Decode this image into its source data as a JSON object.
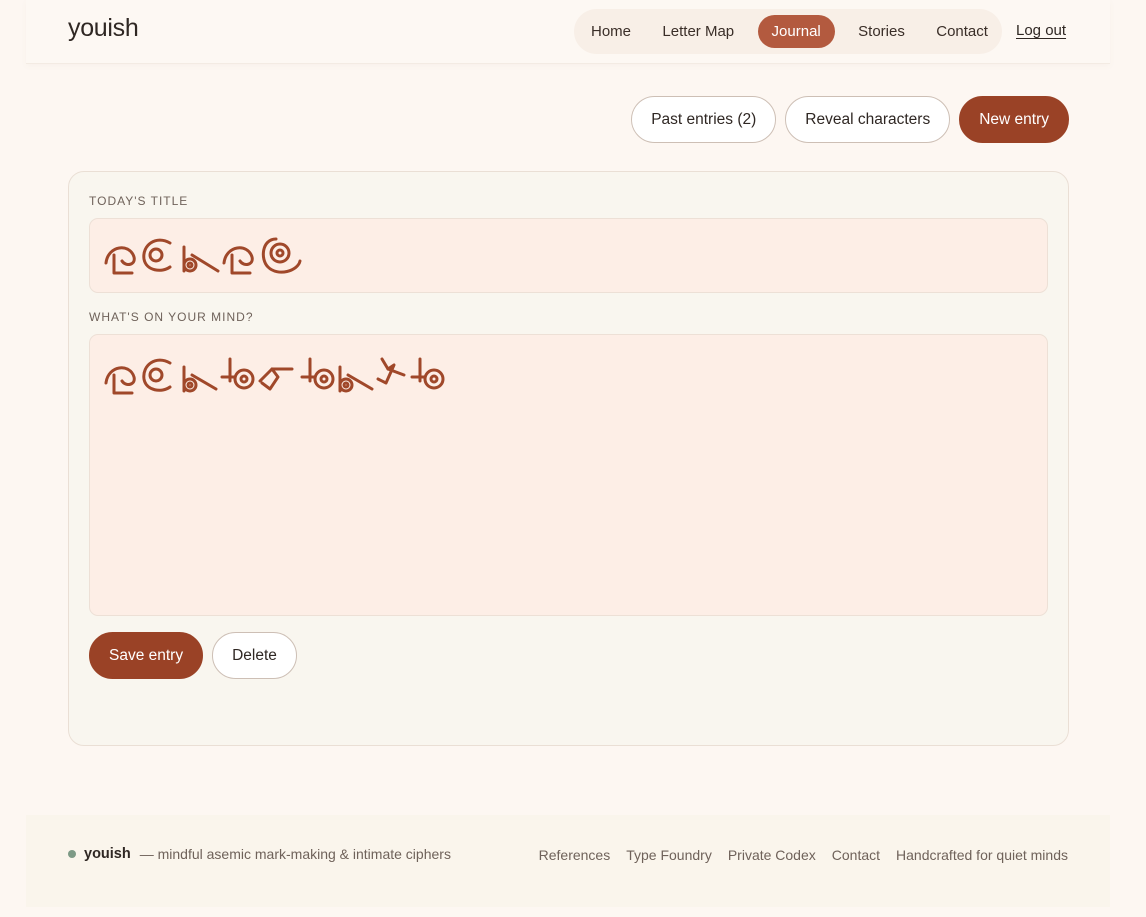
{
  "header": {
    "logo": "youish",
    "nav": [
      {
        "label": "Home",
        "active": false
      },
      {
        "label": "Letter Map",
        "active": false
      },
      {
        "label": "Journal",
        "active": true
      },
      {
        "label": "Stories",
        "active": false
      },
      {
        "label": "Contact",
        "active": false
      }
    ],
    "logout": "Log out"
  },
  "actions": {
    "past_entries": "Past entries (2)",
    "reveal": "Reveal characters",
    "new_entry": "New entry"
  },
  "editor": {
    "title_label": "Today's title",
    "body_label": "What's on your mind?",
    "title_value": "asemic glyph sequence (5 glyphs)",
    "body_value": "asemic glyph sequence (10 glyphs)",
    "save": "Save entry",
    "delete": "Delete"
  },
  "footer": {
    "brand": "youish",
    "tagline": "— mindful asemic mark-making & intimate ciphers",
    "links": [
      "References",
      "Type Foundry",
      "Private Codex",
      "Contact",
      "Handcrafted for quiet minds"
    ]
  },
  "colors": {
    "accent": "#b35a3f",
    "primary_button": "#9a4226",
    "glyph_ink": "#a0482a",
    "status_dot": "#7d9a86"
  }
}
